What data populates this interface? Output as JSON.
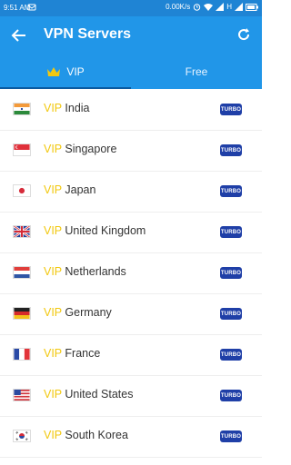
{
  "status_bar": {
    "time": "9:51 AM",
    "network_speed": "0.00K/s",
    "indicator": "H"
  },
  "appbar": {
    "title": "VPN Servers",
    "back_icon": "arrow-left-icon",
    "refresh_icon": "refresh-icon"
  },
  "tabs": [
    {
      "label": "VIP",
      "icon": "crown-icon",
      "active": true
    },
    {
      "label": "Free",
      "active": false
    }
  ],
  "servers": [
    {
      "prefix": "VIP",
      "country": "India",
      "badge": "TURBO",
      "flag": "india-flag-icon"
    },
    {
      "prefix": "VIP",
      "country": "Singapore",
      "badge": "TURBO",
      "flag": "singapore-flag-icon"
    },
    {
      "prefix": "VIP",
      "country": "Japan",
      "badge": "TURBO",
      "flag": "japan-flag-icon"
    },
    {
      "prefix": "VIP",
      "country": "United Kingdom",
      "badge": "TURBO",
      "flag": "uk-flag-icon"
    },
    {
      "prefix": "VIP",
      "country": "Netherlands",
      "badge": "TURBO",
      "flag": "netherlands-flag-icon"
    },
    {
      "prefix": "VIP",
      "country": "Germany",
      "badge": "TURBO",
      "flag": "germany-flag-icon"
    },
    {
      "prefix": "VIP",
      "country": "France",
      "badge": "TURBO",
      "flag": "france-flag-icon"
    },
    {
      "prefix": "VIP",
      "country": "United States",
      "badge": "TURBO",
      "flag": "usa-flag-icon"
    },
    {
      "prefix": "VIP",
      "country": "South Korea",
      "badge": "TURBO",
      "flag": "south-korea-flag-icon"
    }
  ],
  "colors": {
    "primary": "#2196e8",
    "vip": "#f2c80f",
    "turbo": "#1f3fa7"
  }
}
